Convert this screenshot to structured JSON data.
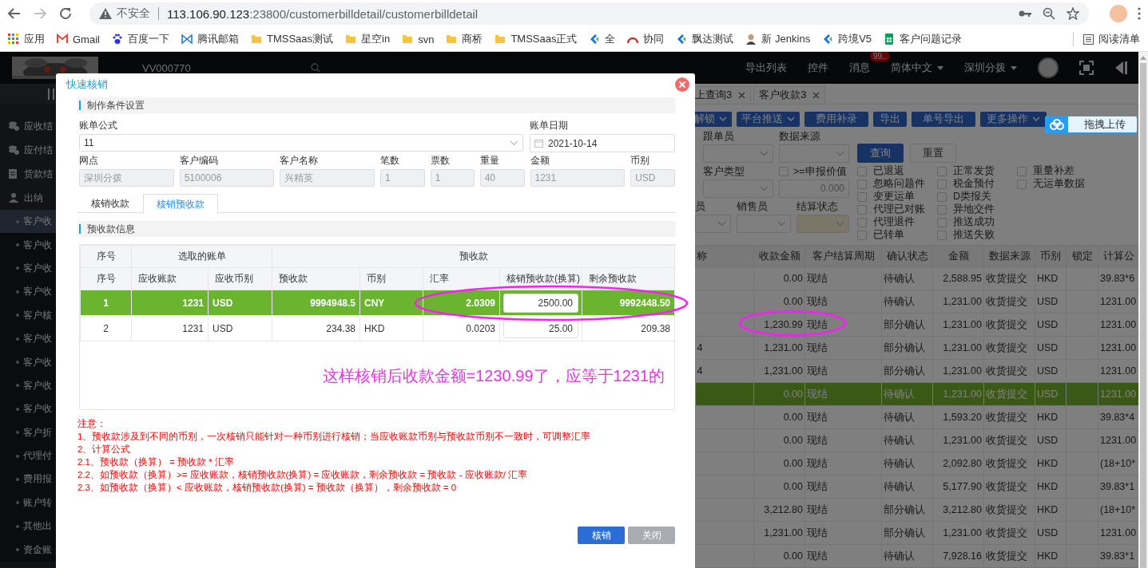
{
  "browser": {
    "security": "不安全",
    "url_host": "113.106.90.123",
    "url_path": ":23800/customerbilldetail/customerbilldetail",
    "bookmarks": [
      {
        "label": "应用"
      },
      {
        "label": "Gmail"
      },
      {
        "label": "百度一下"
      },
      {
        "label": "腾讯邮箱"
      },
      {
        "label": "TMSSaas测试"
      },
      {
        "label": "星空in"
      },
      {
        "label": "svn"
      },
      {
        "label": "商桥"
      },
      {
        "label": "TMSSaas正式"
      },
      {
        "label": "全"
      },
      {
        "label": "协同"
      },
      {
        "label": "飘达测试"
      },
      {
        "label": "新 Jenkins"
      },
      {
        "label": "跨境V5"
      },
      {
        "label": "客户问题记录"
      }
    ],
    "reading_list": "阅读清单"
  },
  "app_header": {
    "user": "VV000770",
    "menu": [
      {
        "label": "导出列表",
        "dropdown": false
      },
      {
        "label": "控件",
        "dropdown": false
      },
      {
        "label": "消息",
        "badge": "99..",
        "dropdown": false
      },
      {
        "label": "简体中文",
        "dropdown": true
      },
      {
        "label": "深圳分拨",
        "dropdown": true
      }
    ]
  },
  "sidebar": {
    "items": [
      {
        "label": "应收结",
        "kind": "section",
        "selected": false
      },
      {
        "label": "应付结",
        "kind": "section",
        "selected": false
      },
      {
        "label": "货款结",
        "kind": "section",
        "selected": false
      },
      {
        "label": "出纳",
        "kind": "section",
        "selected": false
      },
      {
        "label": "客户收",
        "kind": "sub",
        "selected": true
      },
      {
        "label": "客户收",
        "kind": "sub",
        "selected": false
      },
      {
        "label": "客户收",
        "kind": "sub",
        "selected": false
      },
      {
        "label": "客户收",
        "kind": "sub",
        "selected": false
      },
      {
        "label": "客户核",
        "kind": "sub",
        "selected": false
      },
      {
        "label": "客户收",
        "kind": "sub",
        "selected": false
      },
      {
        "label": "客户收",
        "kind": "sub",
        "selected": false
      },
      {
        "label": "客户收",
        "kind": "sub",
        "selected": false
      },
      {
        "label": "客户收",
        "kind": "sub",
        "selected": false
      },
      {
        "label": "客户折",
        "kind": "sub",
        "selected": false
      },
      {
        "label": "代理付",
        "kind": "sub",
        "selected": false
      },
      {
        "label": "费用报",
        "kind": "sub",
        "selected": false
      },
      {
        "label": "账户转",
        "kind": "sub",
        "selected": false
      },
      {
        "label": "其他出",
        "kind": "sub",
        "selected": false
      },
      {
        "label": "资金账",
        "kind": "sub",
        "selected": false
      }
    ]
  },
  "page": {
    "tabs": [
      {
        "label": "上查询3",
        "selected": false
      },
      {
        "label": "客户收款3",
        "selected": false
      }
    ],
    "actions": [
      {
        "label": "解锁",
        "dropdown": true
      },
      {
        "label": "平台推送",
        "dropdown": true
      },
      {
        "label": "费用补录",
        "dropdown": false
      },
      {
        "label": "导出",
        "dropdown": false
      },
      {
        "label": "单号导出",
        "dropdown": false
      },
      {
        "label": "更多操作",
        "dropdown": true
      }
    ],
    "upload": {
      "label": "拖拽上传"
    },
    "filters": [
      [
        {
          "label": "跟单员",
          "kind": "select"
        },
        {
          "label": "数据来源",
          "kind": "select"
        }
      ],
      [
        {
          "label": "客户类型",
          "kind": "select"
        },
        {
          "label": ">=申报价值",
          "kind": "checkinput",
          "checked": false,
          "value": "0.000"
        }
      ],
      [
        {
          "label": "员",
          "kind": "select"
        },
        {
          "label": "销售员",
          "kind": "select"
        },
        {
          "label": "结算状态",
          "kind": "select",
          "highlighted": true
        }
      ]
    ],
    "search_buttons": [
      {
        "label": "查询",
        "kind": "primary"
      },
      {
        "label": "重置",
        "kind": "plain"
      }
    ],
    "checkbox_columns": [
      [
        {
          "label": "已退返",
          "checked": false
        },
        {
          "label": "忽略问题件",
          "checked": false
        },
        {
          "label": "变更运单",
          "checked": false
        },
        {
          "label": "代理已对账",
          "checked": false
        },
        {
          "label": "代理退件",
          "checked": false
        },
        {
          "label": "已转单",
          "checked": false
        }
      ],
      [
        {
          "label": "正常发货",
          "checked": false
        },
        {
          "label": "税金预付",
          "checked": false
        },
        {
          "label": "D类报关",
          "checked": false
        },
        {
          "label": "异地交件",
          "checked": false
        },
        {
          "label": "推送成功",
          "checked": false
        },
        {
          "label": "推送失败",
          "checked": false
        }
      ],
      [
        {
          "label": "重量补差",
          "checked": false
        },
        {
          "label": "无运单数据",
          "checked": false
        }
      ]
    ],
    "table": {
      "columns": [
        {
          "label": "称"
        },
        {
          "label": "收款金额"
        },
        {
          "label": "客户结算周期"
        },
        {
          "label": "确认状态"
        },
        {
          "label": "金额"
        },
        {
          "label": "数据来源"
        },
        {
          "label": "币别"
        },
        {
          "label": "锁定"
        },
        {
          "label": "计算公"
        }
      ],
      "rows": [
        {
          "received": "0.00",
          "cycle": "现结",
          "status": "待确认",
          "amount": "2,588.95",
          "source": "收货提交",
          "currency": "HKD",
          "formula": "39.83*6",
          "selected": false
        },
        {
          "received": "0.00",
          "cycle": "现结",
          "status": "待确认",
          "amount": "1,231.00",
          "source": "收货提交",
          "currency": "USD",
          "formula": "1231.00",
          "selected": false
        },
        {
          "received": "1,230.99",
          "cycle": "现结",
          "status": "部分确认",
          "amount": "1,231.00",
          "source": "收货提交",
          "currency": "USD",
          "formula": "1231.00",
          "selected": false
        },
        {
          "column_1": "4",
          "received": "1,231.00",
          "cycle": "现结",
          "status": "部分确认",
          "amount": "1,231.00",
          "source": "收货提交",
          "currency": "USD",
          "formula": "1231.00",
          "selected": false
        },
        {
          "column_1": "4",
          "received": "1,231.00",
          "cycle": "现结",
          "status": "部分确认",
          "amount": "1,231.00",
          "source": "收货提交",
          "currency": "USD",
          "formula": "1231.00",
          "selected": false
        },
        {
          "received": "0.00",
          "cycle": "现结",
          "status": "待确认",
          "amount": "1,231.00",
          "source": "收货提交",
          "currency": "USD",
          "formula": "1231.00",
          "selected": true
        },
        {
          "received": "0.00",
          "cycle": "现结",
          "status": "待确认",
          "amount": "1,593.20",
          "source": "收货提交",
          "currency": "HKD",
          "formula": "39.83*4",
          "selected": false
        },
        {
          "received": "0.00",
          "cycle": "现结",
          "status": "待确认",
          "amount": "1,231.00",
          "source": "收货提交",
          "currency": "USD",
          "formula": "1231.00",
          "selected": false
        },
        {
          "received": "0.00",
          "cycle": "现结",
          "status": "待确认",
          "amount": "2,092.80",
          "source": "收货提交",
          "currency": "HKD",
          "formula": "(18+10*",
          "selected": false
        },
        {
          "received": "0.00",
          "cycle": "现结",
          "status": "待确认",
          "amount": "5,177.90",
          "source": "收货提交",
          "currency": "HKD",
          "formula": "39.83*1",
          "selected": false
        },
        {
          "received": "3,212.80",
          "cycle": "现结",
          "status": "部分确认",
          "amount": "3,212.80",
          "source": "收货提交",
          "currency": "HKD",
          "formula": "(18+10*",
          "selected": false
        },
        {
          "received": "1,231.00",
          "cycle": "现结",
          "status": "部分确认",
          "amount": "1,231.00",
          "source": "收货提交",
          "currency": "USD",
          "formula": "1231.00",
          "selected": false
        },
        {
          "received": "0.00",
          "cycle": "现结",
          "status": "待确认",
          "amount": "7,928.16",
          "source": "收货提交",
          "currency": "HKD",
          "formula": "39.83*1",
          "selected": false
        }
      ]
    }
  },
  "modal": {
    "title": "快速核销",
    "section_1": "制作条件设置",
    "bill_formula": {
      "label": "账单公式",
      "value": "11"
    },
    "bill_date": {
      "label": "账单日期",
      "value": "2021-10-14"
    },
    "info_fields": [
      {
        "label": "网点",
        "value": "深圳分拨",
        "disabled": true
      },
      {
        "label": "客户编码",
        "value": "5100006",
        "disabled": true
      },
      {
        "label": "客户名称",
        "value": "兴精英",
        "disabled": true
      },
      {
        "label": "笔数",
        "value": "1",
        "disabled": true
      },
      {
        "label": "票数",
        "value": "1",
        "disabled": true
      },
      {
        "label": "重量",
        "value": "40",
        "disabled": true
      },
      {
        "label": "金额",
        "value": "1231",
        "disabled": true
      },
      {
        "label": "币别",
        "value": "USD",
        "disabled": true
      }
    ],
    "tabs": [
      {
        "label": "核销收款",
        "selected": false
      },
      {
        "label": "核销预收款",
        "selected": true
      }
    ],
    "section_2": "预收款信息",
    "table": {
      "group_headers": [
        {
          "label": "序号"
        },
        {
          "label": "选取的账单"
        },
        {
          "label": "预收款"
        }
      ],
      "columns": [
        {
          "label": "序号"
        },
        {
          "label": "应收账款"
        },
        {
          "label": "应收币别"
        },
        {
          "label": "预收款"
        },
        {
          "label": "币别"
        },
        {
          "label": "汇率"
        },
        {
          "label": "核销预收款(换算)"
        },
        {
          "label": "剩余预收款"
        }
      ],
      "rows": [
        {
          "no": "1",
          "receivable": "1231",
          "receivable_currency": "USD",
          "prepaid": "9994948.5",
          "currency": "CNY",
          "rate": "2.0309",
          "write_off": "2500.00",
          "remaining": "9992448.50",
          "selected": true
        },
        {
          "no": "2",
          "receivable": "1231",
          "receivable_currency": "USD",
          "prepaid": "234.38",
          "currency": "HKD",
          "rate": "0.0203",
          "write_off": "25.00",
          "remaining": "209.38",
          "selected": false
        }
      ]
    },
    "annotation": "这样核销后收款金额=1230.99了，应等于1231的",
    "notes": [
      "注意：",
      "1、预收款涉及到不同的币别，一次核销只能针对一种币别进行核销；当应收账款币别与预收款币别不一致时，可调整汇率",
      "2、计算公式",
      "2.1、预收款（换算） = 预收款 * 汇率",
      "2.2、如预收款（换算）>= 应收账款，核销预收款(换算) = 应收账款，剩余预收款 = 预收款 - 应收账款/ 汇率",
      "2.3、如预收款（换算）< 应收账款，核销预收款(换算) = 预收款（换算），剩余预收款 = 0"
    ],
    "buttons": [
      {
        "label": "核销",
        "kind": "primary"
      },
      {
        "label": "关闭",
        "kind": "secondary"
      }
    ]
  }
}
